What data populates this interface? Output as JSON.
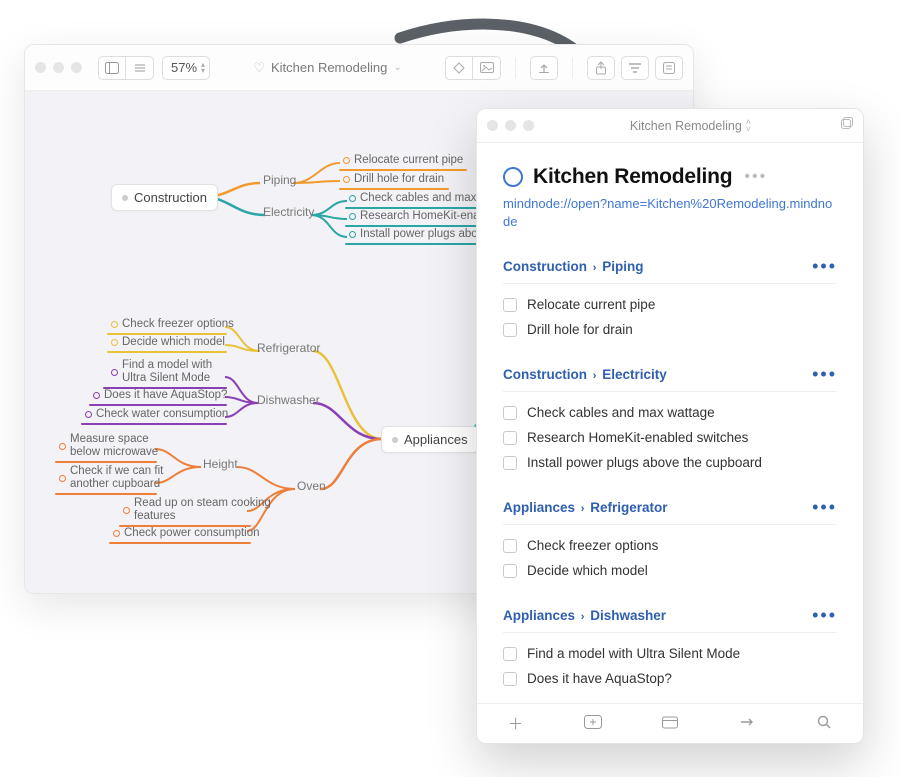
{
  "mindmap": {
    "title": "Kitchen Remodeling",
    "zoom": "57%",
    "nodes": {
      "construction": "Construction",
      "appliances": "Appliances"
    },
    "branches": {
      "piping": "Piping",
      "electricity": "Electricity",
      "refrigerator": "Refrigerator",
      "dishwasher": "Dishwasher",
      "height": "Height",
      "oven": "Oven"
    },
    "leaves": {
      "relocate_pipe": "Relocate current pipe",
      "drill_hole": "Drill hole for drain",
      "check_cables": "Check cables and max wattage",
      "homekit": "Research HomeKit-enabled swit",
      "power_plugs": "Install power plugs above the cu",
      "freezer": "Check freezer options",
      "decide_model": "Decide which model",
      "ultra_silent": "Find a model with\nUltra Silent Mode",
      "aquastop": "Does it have AquaStop?",
      "water": "Check water consumption",
      "measure_space": "Measure space\nbelow microwave",
      "fit_cupboard": "Check if we can fit\nanother cupboard",
      "steam": "Read up on steam cooking\nfeatures",
      "power_cons": "Check power consumption"
    },
    "colors": {
      "orange": "#f29a2e",
      "teal": "#2aa6a6",
      "yellow": "#e9c23a",
      "purple": "#8a3fb5",
      "orange2": "#ee7f3a",
      "cyan": "#35b7cc"
    }
  },
  "things": {
    "title": "Kitchen Remodeling",
    "heading": "Kitchen Remodeling",
    "url": "mindnode://open?name=Kitchen%20Remodeling.mindnode",
    "sections": [
      {
        "path": [
          "Construction",
          "Piping"
        ],
        "tasks": [
          "Relocate current pipe",
          "Drill hole for drain"
        ]
      },
      {
        "path": [
          "Construction",
          "Electricity"
        ],
        "tasks": [
          "Check cables and max wattage",
          "Research HomeKit-enabled switches",
          "Install power plugs above the cupboard"
        ]
      },
      {
        "path": [
          "Appliances",
          "Refrigerator"
        ],
        "tasks": [
          "Check freezer options",
          "Decide which model"
        ]
      },
      {
        "path": [
          "Appliances",
          "Dishwasher"
        ],
        "tasks": [
          "Find a model with Ultra Silent Mode",
          "Does it have AquaStop?"
        ]
      }
    ]
  }
}
